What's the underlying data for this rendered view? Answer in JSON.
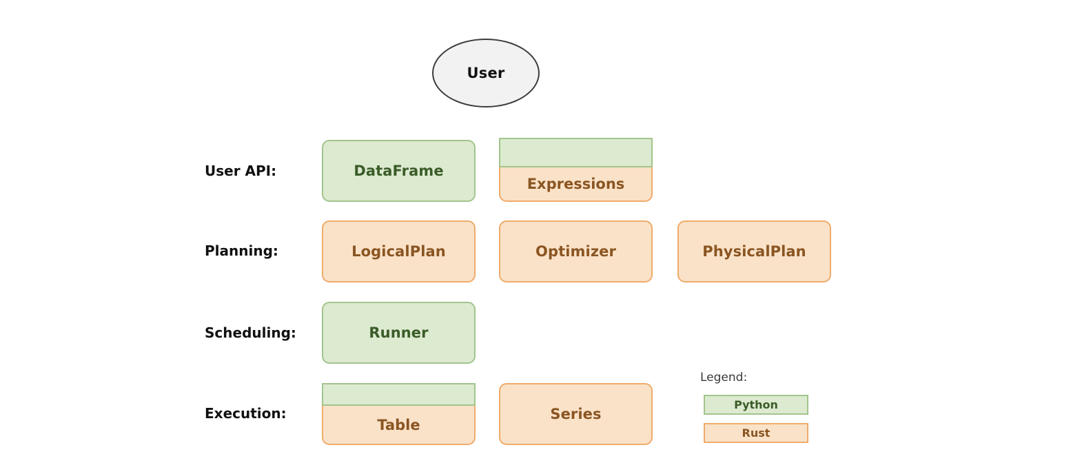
{
  "diagram": {
    "title_node": {
      "label": "User",
      "shape": "ellipse",
      "fill": "#f2f2f2",
      "stroke": "#3b3b3b"
    },
    "rows": [
      {
        "label": "User API:",
        "nodes": [
          {
            "label": "DataFrame",
            "lang": "python"
          },
          {
            "label": "Expressions",
            "lang": "split"
          }
        ]
      },
      {
        "label": "Planning:",
        "nodes": [
          {
            "label": "LogicalPlan",
            "lang": "rust"
          },
          {
            "label": "Optimizer",
            "lang": "rust"
          },
          {
            "label": "PhysicalPlan",
            "lang": "rust"
          }
        ]
      },
      {
        "label": "Scheduling:",
        "nodes": [
          {
            "label": "Runner",
            "lang": "python"
          }
        ]
      },
      {
        "label": "Execution:",
        "nodes": [
          {
            "label": "Table",
            "lang": "split"
          },
          {
            "label": "Series",
            "lang": "rust"
          }
        ]
      }
    ],
    "legend": {
      "title": "Legend:",
      "items": [
        {
          "label": "Python",
          "color": "#dcead0",
          "border": "#a2c48c",
          "text_color": "#3a5c28"
        },
        {
          "label": "Rust",
          "color": "#fae2c8",
          "border": "#efab6b",
          "text_color": "#8a5522"
        }
      ]
    },
    "colors": {
      "python_fill": "#dcead0",
      "python_border": "#a2c48c",
      "python_text": "#3a5c28",
      "rust_fill": "#fae2c8",
      "rust_border": "#efab6b",
      "rust_text": "#8a5522",
      "background": "#ffffff",
      "label_text": "#111111"
    }
  }
}
